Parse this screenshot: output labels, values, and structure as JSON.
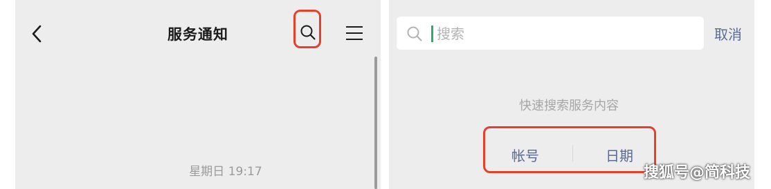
{
  "left": {
    "title": "服务通知",
    "timestamp": "星期日 19:17",
    "icons": {
      "back": "chevron-left-icon",
      "search": "search-icon",
      "menu": "hamburger-menu-icon"
    }
  },
  "right": {
    "search": {
      "placeholder": "搜索",
      "value": ""
    },
    "cancel_label": "取消",
    "hint": "快速搜索服务内容",
    "filters": [
      {
        "label": "帐号"
      },
      {
        "label": "日期"
      }
    ]
  },
  "watermark": "搜狐号@简科技",
  "colors": {
    "highlight": "#e6402a",
    "link": "#576b95",
    "caret": "#2aae67",
    "background": "#ededed"
  }
}
